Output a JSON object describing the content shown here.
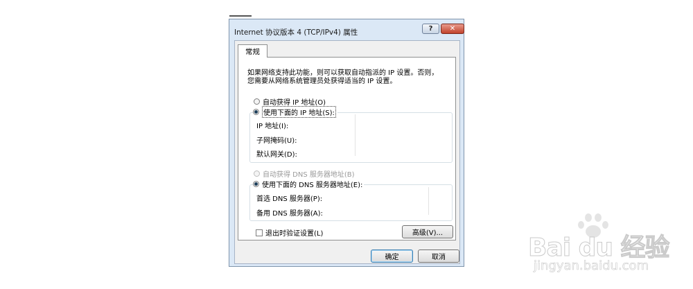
{
  "window": {
    "title": "Internet 协议版本 4 (TCP/IPv4) 属性",
    "help_label": "?",
    "close_label": "✕"
  },
  "tabs": [
    {
      "label": "常规"
    }
  ],
  "general": {
    "intro_line1": "如果网络支持此功能，则可以获取自动指派的 IP 设置。否则，",
    "intro_line2": "您需要从网络系统管理员处获得适当的 IP 设置。",
    "ip_auto_label": "自动获得 IP 地址(O)",
    "ip_manual_label": "使用下面的 IP 地址(S):",
    "ip_mode": "manual",
    "ip_address_label": "IP 地址(I):",
    "subnet_mask_label": "子网掩码(U):",
    "default_gateway_label": "默认网关(D):",
    "dns_auto_label": "自动获得 DNS 服务器地址(B)",
    "dns_manual_label": "使用下面的 DNS 服务器地址(E):",
    "dns_mode": "manual",
    "preferred_dns_label": "首选 DNS 服务器(P):",
    "alternate_dns_label": "备用 DNS 服务器(A):",
    "validate_label": "退出时验证设置(L)",
    "validate_checked": false,
    "advanced_label": "高级(V)..."
  },
  "footer": {
    "ok_label": "确定",
    "cancel_label": "取消"
  },
  "watermark": {
    "logo_text": "Bai du 经验",
    "url": "jingyan.baidu.com"
  }
}
